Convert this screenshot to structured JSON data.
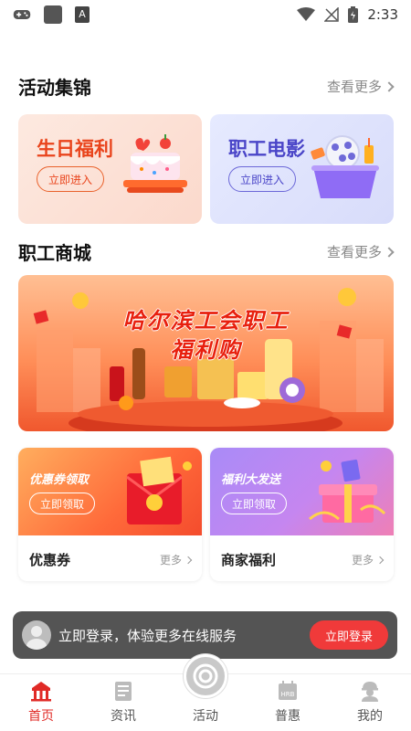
{
  "status_bar": {
    "time": "2:33",
    "launcher_letter": "A"
  },
  "sections": {
    "activities": {
      "title": "活动集锦",
      "more": "查看更多"
    },
    "mall": {
      "title": "职工商城",
      "more": "查看更多"
    }
  },
  "activity_cards": [
    {
      "title": "生日福利",
      "button": "立即进入"
    },
    {
      "title": "职工电影",
      "button": "立即进入"
    }
  ],
  "banner": {
    "line1": "哈尔滨工会职工",
    "line2": "福利购"
  },
  "promo_cards": [
    {
      "tag": "优惠券领取",
      "button": "立即领取",
      "name": "优惠券",
      "more": "更多"
    },
    {
      "tag": "福利大发送",
      "button": "立即领取",
      "name": "商家福利",
      "more": "更多"
    }
  ],
  "login_bar": {
    "text": "立即登录，体验更多在线服务",
    "button": "立即登录"
  },
  "tabs": [
    {
      "label": "首页",
      "icon": "home-icon",
      "active": true
    },
    {
      "label": "资讯",
      "icon": "news-icon"
    },
    {
      "label": "活动",
      "icon": "activity-icon"
    },
    {
      "label": "普惠",
      "icon": "benefit-icon",
      "badge": "HRB"
    },
    {
      "label": "我的",
      "icon": "profile-icon"
    }
  ],
  "colors": {
    "primary": "#e02a26",
    "login_button": "#f03a3a",
    "movie_accent": "#4a45c8"
  }
}
